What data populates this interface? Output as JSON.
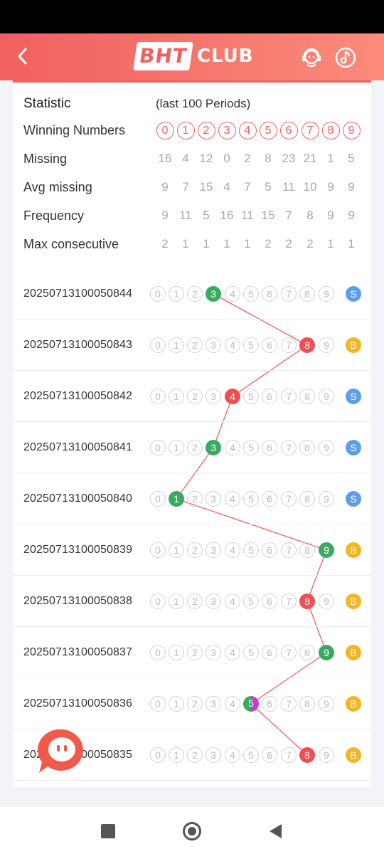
{
  "header": {
    "logo_main": "BHT",
    "logo_sub": "CLUB"
  },
  "stats": {
    "title": "Statistic",
    "subtitle": "(last 100 Periods)",
    "winning_label": "Winning Numbers",
    "digits": [
      "0",
      "1",
      "2",
      "3",
      "4",
      "5",
      "6",
      "7",
      "8",
      "9"
    ],
    "rows": [
      {
        "label": "Missing",
        "values": [
          "16",
          "4",
          "12",
          "0",
          "2",
          "8",
          "23",
          "21",
          "1",
          "5"
        ]
      },
      {
        "label": "Avg missing",
        "values": [
          "9",
          "7",
          "15",
          "4",
          "7",
          "5",
          "11",
          "10",
          "9",
          "9"
        ]
      },
      {
        "label": "Frequency",
        "values": [
          "9",
          "11",
          "5",
          "16",
          "11",
          "15",
          "7",
          "8",
          "9",
          "9"
        ]
      },
      {
        "label": "Max consecutive",
        "values": [
          "2",
          "1",
          "1",
          "1",
          "1",
          "2",
          "2",
          "2",
          "1",
          "1"
        ]
      }
    ]
  },
  "colors": {
    "green": "#3aaa62",
    "red": "#ef4f52",
    "violet": "#c23dd3",
    "small": "#5f9de6",
    "big": "#f0b624",
    "accent": "#f0605f"
  },
  "history": [
    {
      "period": "20250713100050844",
      "winner": 3,
      "color": "green",
      "size": "S"
    },
    {
      "period": "20250713100050843",
      "winner": 8,
      "color": "red",
      "size": "B"
    },
    {
      "period": "20250713100050842",
      "winner": 4,
      "color": "red",
      "size": "S"
    },
    {
      "period": "20250713100050841",
      "winner": 3,
      "color": "green",
      "size": "S"
    },
    {
      "period": "20250713100050840",
      "winner": 1,
      "color": "green",
      "size": "S"
    },
    {
      "period": "20250713100050839",
      "winner": 9,
      "color": "green",
      "size": "B"
    },
    {
      "period": "20250713100050838",
      "winner": 8,
      "color": "red",
      "size": "B"
    },
    {
      "period": "20250713100050837",
      "winner": 9,
      "color": "green",
      "size": "B"
    },
    {
      "period": "20250713100050836",
      "winner": 5,
      "color": "violet",
      "size": "B"
    },
    {
      "period": "20250713100050835",
      "winner": 8,
      "color": "red",
      "size": "B"
    }
  ],
  "icons": {
    "back": "chevron-left-icon",
    "support": "customer-support-icon",
    "music": "music-note-icon",
    "chat": "chat-bubble-icon"
  }
}
